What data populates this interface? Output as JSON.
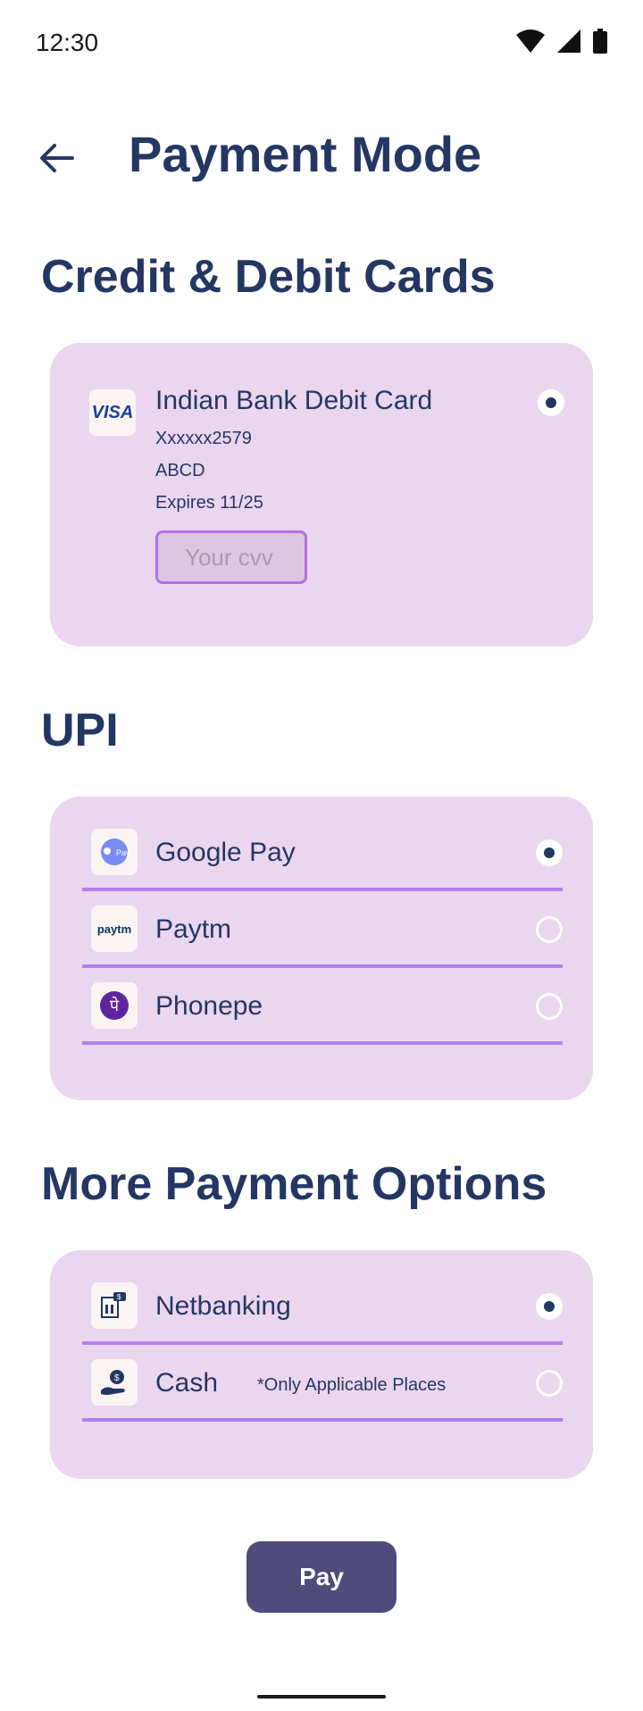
{
  "status_bar": {
    "time": "12:30"
  },
  "header": {
    "title": "Payment Mode"
  },
  "sections": {
    "cards": {
      "title": "Credit & Debit Cards",
      "card": {
        "logo_text": "VISA",
        "name": "Indian Bank Debit Card",
        "number": "Xxxxxx2579",
        "holder": "ABCD",
        "expiry": "Expires 11/25",
        "cvv_placeholder": "Your cvv",
        "selected": true
      }
    },
    "upi": {
      "title": "UPI",
      "options": [
        {
          "label": "Google Pay",
          "icon": "google-pay-icon",
          "selected": true
        },
        {
          "label": "Paytm",
          "logo_text": "paytm",
          "icon": "paytm-icon",
          "selected": false
        },
        {
          "label": "Phonepe",
          "logo_text": "पे",
          "icon": "phonepe-icon",
          "selected": false
        }
      ]
    },
    "more": {
      "title": "More Payment Options",
      "options": [
        {
          "label": "Netbanking",
          "icon": "bank-icon",
          "selected": true
        },
        {
          "label": "Cash",
          "note": "*Only Applicable Places",
          "icon": "cash-hand-icon",
          "selected": false
        }
      ]
    }
  },
  "actions": {
    "pay_label": "Pay"
  },
  "colors": {
    "primary_text": "#243763",
    "card_bg": "#EBD6EF",
    "divider": "#B57FF0",
    "button_bg": "#4F4B7A"
  }
}
